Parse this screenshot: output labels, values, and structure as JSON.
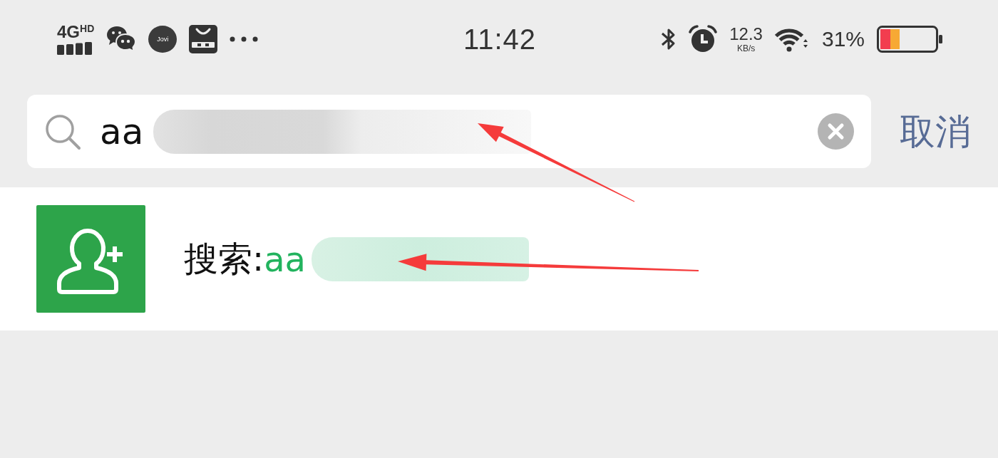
{
  "status_bar": {
    "left": [
      {
        "kind": "network",
        "type": "4G",
        "badge": "HD"
      },
      {
        "kind": "chat"
      },
      {
        "kind": "app",
        "label": "Jovi"
      },
      {
        "kind": "store"
      },
      {
        "kind": "more"
      }
    ],
    "time": "11:42",
    "right": [
      {
        "kind": "bluetooth"
      },
      {
        "kind": "alarm"
      },
      {
        "kind": "speed",
        "value": "12.3",
        "unit": "KB/s"
      },
      {
        "kind": "wifi"
      },
      {
        "kind": "battery_text",
        "text": "31%"
      },
      {
        "kind": "battery"
      }
    ]
  },
  "search_bar": {
    "value": "aa",
    "value_redacted": true,
    "annotated": true,
    "cancel": "取消"
  },
  "results": [
    {
      "kind": "add_contact",
      "label": "搜索:",
      "query": "aa",
      "query_redacted": true,
      "annotated": true
    }
  ]
}
